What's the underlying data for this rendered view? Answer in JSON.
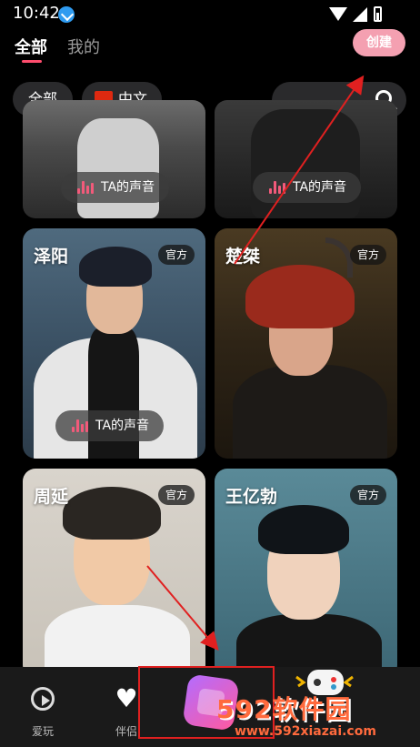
{
  "status_bar": {
    "time": "10:42"
  },
  "header": {
    "tabs": [
      {
        "label": "全部",
        "active": true
      },
      {
        "label": "我的",
        "active": false
      }
    ],
    "create_label": "创建"
  },
  "filters": {
    "all_label": "全部",
    "language_label": "中文"
  },
  "cards": [
    {
      "name": "",
      "voice_label": "TA的声音"
    },
    {
      "name": "",
      "voice_label": "TA的声音"
    },
    {
      "name": "泽阳",
      "badge": "官方",
      "voice_label": "TA的声音"
    },
    {
      "name": "楚桀",
      "badge": "官方"
    },
    {
      "name": "周延",
      "badge": "官方"
    },
    {
      "name": "王亿勃",
      "badge": "官方"
    }
  ],
  "bottom_nav": {
    "items": [
      {
        "label": "爱玩",
        "icon": "play-icon"
      },
      {
        "label": "伴侣",
        "icon": "heart-icon"
      }
    ]
  },
  "watermark": {
    "brand": "592软件园",
    "url": "www.592xiazai.com"
  },
  "colors": {
    "accent": "#ff4d6d",
    "create_button": "#f4a0b1",
    "annotation": "#e02020"
  }
}
